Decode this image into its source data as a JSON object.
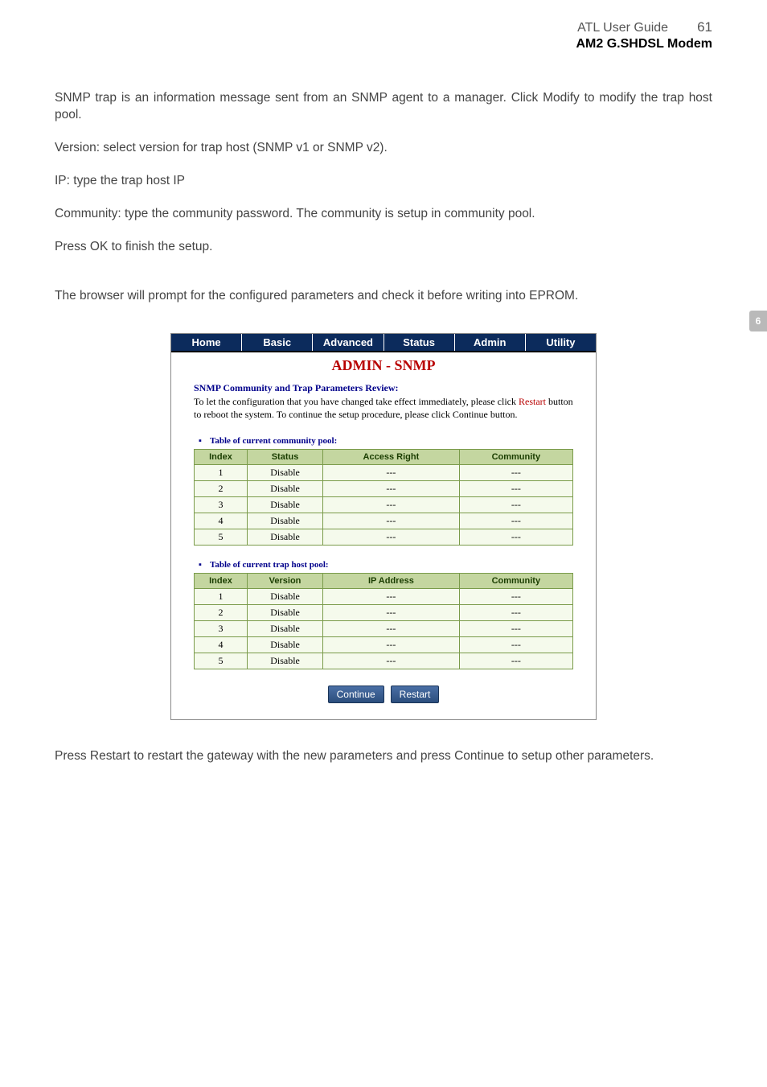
{
  "header": {
    "title": "ATL User Guide",
    "page_number": "61",
    "subtitle": "AM2 G.SHDSL Modem"
  },
  "side_tab": "6",
  "body": {
    "p1": "SNMP trap is an information message sent from an SNMP agent to a manager. Click Modify to modify the trap host pool.",
    "p2": "Version: select version for trap host (SNMP v1 or SNMP v2).",
    "p3": "IP: type the trap host IP",
    "p4": "Community: type the community password. The community is setup in community pool.",
    "p5": "Press OK to finish the setup.",
    "p6": "The browser will prompt for the configured parameters and check it before writing into EPROM."
  },
  "screenshot": {
    "tabs": [
      "Home",
      "Basic",
      "Advanced",
      "Status",
      "Admin",
      "Utility"
    ],
    "title": "ADMIN - SNMP",
    "heading": "SNMP Community and Trap Parameters Review:",
    "desc_pre": "To let the configuration that you have changed take effect immediately,  please click ",
    "desc_restart": "Restart",
    "desc_post": " button to reboot the system.  To continue the setup procedure, please click Continue button.",
    "table1": {
      "caption": "Table of current community pool:",
      "headers": [
        "Index",
        "Status",
        "Access Right",
        "Community"
      ],
      "rows": [
        [
          "1",
          "Disable",
          "---",
          "---"
        ],
        [
          "2",
          "Disable",
          "---",
          "---"
        ],
        [
          "3",
          "Disable",
          "---",
          "---"
        ],
        [
          "4",
          "Disable",
          "---",
          "---"
        ],
        [
          "5",
          "Disable",
          "---",
          "---"
        ]
      ]
    },
    "table2": {
      "caption": "Table of current trap host pool:",
      "headers": [
        "Index",
        "Version",
        "IP Address",
        "Community"
      ],
      "rows": [
        [
          "1",
          "Disable",
          "---",
          "---"
        ],
        [
          "2",
          "Disable",
          "---",
          "---"
        ],
        [
          "3",
          "Disable",
          "---",
          "---"
        ],
        [
          "4",
          "Disable",
          "---",
          "---"
        ],
        [
          "5",
          "Disable",
          "---",
          "---"
        ]
      ]
    },
    "buttons": {
      "continue": "Continue",
      "restart": "Restart"
    }
  },
  "footer": "Press Restart to restart the gateway with the new parameters and press Continue to setup other parameters."
}
